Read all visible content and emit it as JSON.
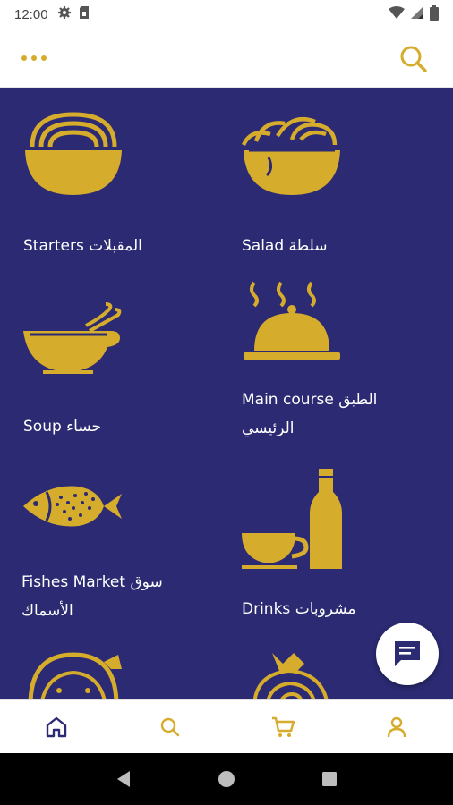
{
  "status_bar": {
    "time": "12:00",
    "icons": [
      "gear-icon",
      "sim-card-icon",
      "wifi-icon",
      "signal-icon",
      "battery-icon"
    ]
  },
  "header": {
    "menu_icon": "more-dots-icon",
    "search_icon": "search-icon"
  },
  "categories": [
    {
      "label": "Starters المقبلات",
      "icon": "noodle-bowl-icon"
    },
    {
      "label": "Salad سلطة",
      "icon": "salad-bowl-icon"
    },
    {
      "label": "Soup حساء",
      "icon": "soup-bowl-icon"
    },
    {
      "label": "Main course الطبق",
      "label_line2": "الرئيسي",
      "icon": "cloche-icon"
    },
    {
      "label": "Fishes Market سوق",
      "label_line2": "الأسماك",
      "icon": "fish-icon"
    },
    {
      "label": "Drinks مشروبات",
      "icon": "drinks-icon"
    },
    {
      "icon": "kids-face-icon"
    },
    {
      "icon": "pasta-icon"
    }
  ],
  "fab": {
    "icon": "chat-icon"
  },
  "bottom_nav": [
    "home-icon",
    "search-icon",
    "cart-icon",
    "profile-icon"
  ],
  "system_nav": [
    "back-icon",
    "home-circle-icon",
    "recents-icon"
  ],
  "colors": {
    "primary": "#2b2a72",
    "accent": "#d6ac2c",
    "surface": "#ffffff",
    "nav_active": "#2b2a72"
  }
}
